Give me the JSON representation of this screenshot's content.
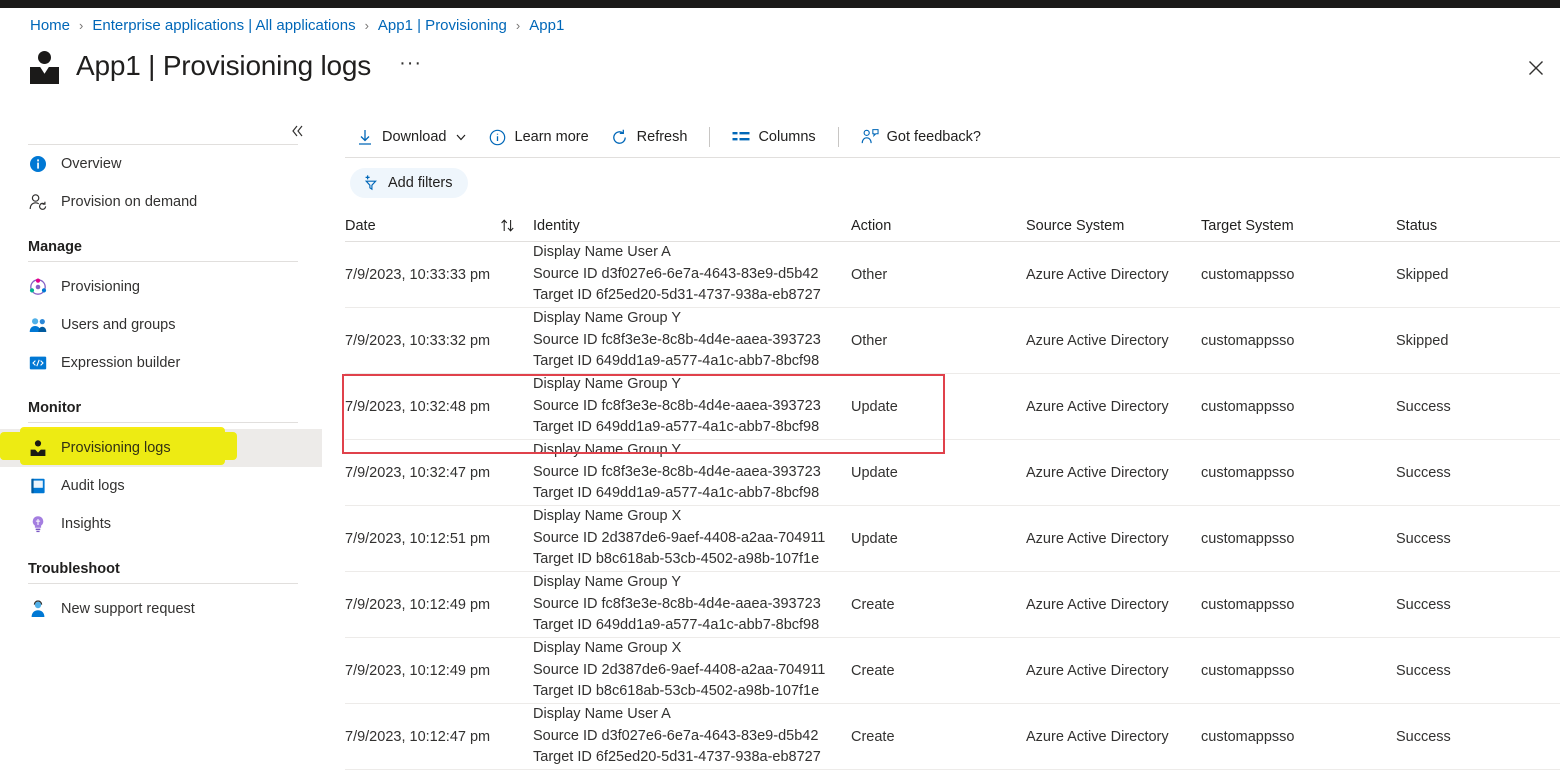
{
  "breadcrumb": [
    {
      "label": "Home"
    },
    {
      "label": "Enterprise applications | All applications"
    },
    {
      "label": "App1 | Provisioning"
    },
    {
      "label": "App1"
    }
  ],
  "breadcrumb_separator": "›",
  "header": {
    "title": "App1 | Provisioning logs",
    "ellipsis": "···",
    "close_label": "✕"
  },
  "sidebar": {
    "collapse_label": "«",
    "top_items": [
      {
        "label": "Overview",
        "icon": "info-icon",
        "selected": false
      },
      {
        "label": "Provision on demand",
        "icon": "provision-on-demand-icon",
        "selected": false
      }
    ],
    "groups": [
      {
        "title": "Manage",
        "items": [
          {
            "label": "Provisioning",
            "icon": "provisioning-icon",
            "selected": false
          },
          {
            "label": "Users and groups",
            "icon": "users-groups-icon",
            "selected": false
          },
          {
            "label": "Expression builder",
            "icon": "expression-builder-icon",
            "selected": false
          }
        ]
      },
      {
        "title": "Monitor",
        "items": [
          {
            "label": "Provisioning logs",
            "icon": "provisioning-logs-icon",
            "selected": true,
            "highlighted": true
          },
          {
            "label": "Audit logs",
            "icon": "audit-logs-icon",
            "selected": false
          },
          {
            "label": "Insights",
            "icon": "insights-icon",
            "selected": false
          }
        ]
      },
      {
        "title": "Troubleshoot",
        "items": [
          {
            "label": "New support request",
            "icon": "support-request-icon",
            "selected": false
          }
        ]
      }
    ]
  },
  "toolbar": {
    "download_label": "Download",
    "learn_more_label": "Learn more",
    "refresh_label": "Refresh",
    "columns_label": "Columns",
    "feedback_label": "Got feedback?",
    "add_filters_label": "Add filters"
  },
  "table": {
    "columns": [
      "Date",
      "Identity",
      "Action",
      "Source System",
      "Target System",
      "Status"
    ],
    "sort_column": "Date",
    "rows": [
      {
        "date": "7/9/2023, 10:33:33 pm",
        "display_name": "Display Name User A",
        "source_id": "Source ID d3f027e6-6e7a-4643-83e9-d5b42",
        "target_id": "Target ID 6f25ed20-5d31-4737-938a-eb8727",
        "action": "Other",
        "source_system": "Azure Active Directory",
        "target_system": "customappsso",
        "status": "Skipped"
      },
      {
        "date": "7/9/2023, 10:33:32 pm",
        "display_name": "Display Name Group Y",
        "source_id": "Source ID fc8f3e3e-8c8b-4d4e-aaea-393723",
        "target_id": "Target ID 649dd1a9-a577-4a1c-abb7-8bcf98",
        "action": "Other",
        "source_system": "Azure Active Directory",
        "target_system": "customappsso",
        "status": "Skipped"
      },
      {
        "date": "7/9/2023, 10:32:48 pm",
        "display_name": "Display Name Group Y",
        "source_id": "Source ID fc8f3e3e-8c8b-4d4e-aaea-393723",
        "target_id": "Target ID 649dd1a9-a577-4a1c-abb7-8bcf98",
        "action": "Update",
        "source_system": "Azure Active Directory",
        "target_system": "customappsso",
        "status": "Success"
      },
      {
        "date": "7/9/2023, 10:32:47 pm",
        "display_name": "Display Name Group Y",
        "source_id": "Source ID fc8f3e3e-8c8b-4d4e-aaea-393723",
        "target_id": "Target ID 649dd1a9-a577-4a1c-abb7-8bcf98",
        "action": "Update",
        "source_system": "Azure Active Directory",
        "target_system": "customappsso",
        "status": "Success"
      },
      {
        "date": "7/9/2023, 10:12:51 pm",
        "display_name": "Display Name Group X",
        "source_id": "Source ID 2d387de6-9aef-4408-a2aa-704911",
        "target_id": "Target ID b8c618ab-53cb-4502-a98b-107f1e",
        "action": "Update",
        "source_system": "Azure Active Directory",
        "target_system": "customappsso",
        "status": "Success"
      },
      {
        "date": "7/9/2023, 10:12:49 pm",
        "display_name": "Display Name Group Y",
        "source_id": "Source ID fc8f3e3e-8c8b-4d4e-aaea-393723",
        "target_id": "Target ID 649dd1a9-a577-4a1c-abb7-8bcf98",
        "action": "Create",
        "source_system": "Azure Active Directory",
        "target_system": "customappsso",
        "status": "Success"
      },
      {
        "date": "7/9/2023, 10:12:49 pm",
        "display_name": "Display Name Group X",
        "source_id": "Source ID 2d387de6-9aef-4408-a2aa-704911",
        "target_id": "Target ID b8c618ab-53cb-4502-a98b-107f1e",
        "action": "Create",
        "source_system": "Azure Active Directory",
        "target_system": "customappsso",
        "status": "Success"
      },
      {
        "date": "7/9/2023, 10:12:47 pm",
        "display_name": "Display Name User A",
        "source_id": "Source ID d3f027e6-6e7a-4643-83e9-d5b42",
        "target_id": "Target ID 6f25ed20-5d31-4737-938a-eb8727",
        "action": "Create",
        "source_system": "Azure Active Directory",
        "target_system": "customappsso",
        "status": "Success"
      }
    ]
  },
  "annotations": {
    "highlight_color": "#f7ec13",
    "box_color": "#e0414b",
    "highlighted_row_index": 2
  }
}
